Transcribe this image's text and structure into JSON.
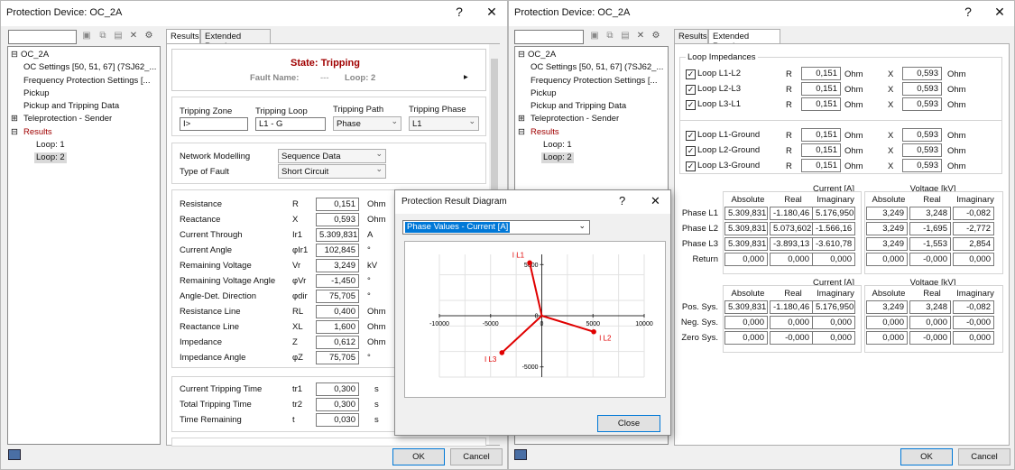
{
  "left": {
    "title": "Protection Device: OC_2A",
    "help": "?",
    "close": "✕",
    "tree": [
      {
        "label": "OC_2A"
      },
      {
        "label": "OC Settings [50, 51, 67] (7SJ62_..."
      },
      {
        "label": "Frequency Protection Settings [..."
      },
      {
        "label": "Pickup"
      },
      {
        "label": "Pickup and Tripping Data"
      },
      {
        "label": "Teleprotection - Sender"
      },
      {
        "label": "Results"
      },
      {
        "label": "Loop: 1"
      },
      {
        "label": "Loop: 2"
      }
    ],
    "tabs": [
      "Results",
      "Extended Results"
    ],
    "state": "State:  Tripping",
    "fault_name_label": "Fault Name:",
    "fault_name_value": "---",
    "loop_label": "Loop:  2",
    "arrow": "▸",
    "trip_headers": [
      "Tripping Zone",
      "Tripping Loop",
      "Tripping Path",
      "Tripping Phase"
    ],
    "trip_values": [
      "I>",
      "L1 - G",
      "Phase",
      "L1"
    ],
    "network_label": "Network Modelling",
    "network_value": "Sequence Data",
    "fault_type_label": "Type of Fault",
    "fault_type_value": "Short Circuit",
    "rows": [
      {
        "name": "Resistance",
        "sym": "R",
        "val": "0,151",
        "unit": "Ohm"
      },
      {
        "name": "Reactance",
        "sym": "X",
        "val": "0,593",
        "unit": "Ohm"
      },
      {
        "name": "Current Through",
        "sym": "Ir1",
        "val": "5.309,831",
        "unit": "A"
      },
      {
        "name": "Current Angle",
        "sym": "φIr1",
        "val": "102,845",
        "unit": "°"
      },
      {
        "name": "Remaining Voltage",
        "sym": "Vr",
        "val": "3,249",
        "unit": "kV"
      },
      {
        "name": "Remaining Voltage Angle",
        "sym": "φVr",
        "val": "-1,450",
        "unit": "°"
      },
      {
        "name": "Angle-Det. Direction",
        "sym": "φdir",
        "val": "75,705",
        "unit": "°"
      },
      {
        "name": "Resistance Line",
        "sym": "RL",
        "val": "0,400",
        "unit": "Ohm"
      },
      {
        "name": "Reactance Line",
        "sym": "XL",
        "val": "1,600",
        "unit": "Ohm"
      },
      {
        "name": "Impedance",
        "sym": "Z",
        "val": "0,612",
        "unit": "Ohm"
      },
      {
        "name": "Impedance Angle",
        "sym": "φZ",
        "val": "75,705",
        "unit": "°"
      }
    ],
    "time_rows": [
      {
        "name": "Current Tripping Time",
        "sym": "tr1",
        "val": "0,300",
        "unit": "s"
      },
      {
        "name": "Total Tripping Time",
        "sym": "tr2",
        "val": "0,300",
        "unit": "s"
      },
      {
        "name": "Time Remaining",
        "sym": "t",
        "val": "0,030",
        "unit": "s"
      }
    ],
    "ok": "OK",
    "cancel": "Cancel"
  },
  "dialog": {
    "title": "Protection Result Diagram",
    "help": "?",
    "close": "✕",
    "select_value": "Phase Values - Current [A]",
    "close_button": "Close"
  },
  "chart_data": {
    "type": "scatter",
    "title": "",
    "xlim": [
      -10000,
      10000
    ],
    "ylim": [
      -6000,
      6000
    ],
    "x_ticks": [
      -10000,
      -5000,
      0,
      5000,
      10000
    ],
    "y_ticks": [
      -5000,
      0,
      5000
    ],
    "series": [
      {
        "name": "I L1",
        "x": -1180.46,
        "y": 5176.95
      },
      {
        "name": "I L2",
        "x": 5073.602,
        "y": -1566.16
      },
      {
        "name": "I L3",
        "x": -3893.13,
        "y": -3610.78
      }
    ],
    "color": "#e00000"
  },
  "right": {
    "title": "Protection Device: OC_2A",
    "tabs": [
      "Results",
      "Extended Results"
    ],
    "loop_imp_title": "Loop Impedances",
    "loops": [
      {
        "name": "Loop L1-L2",
        "r": "0,151",
        "x": "0,593"
      },
      {
        "name": "Loop L2-L3",
        "r": "0,151",
        "x": "0,593"
      },
      {
        "name": "Loop L3-L1",
        "r": "0,151",
        "x": "0,593"
      },
      {
        "name": "Loop L1-Ground",
        "r": "0,151",
        "x": "0,593"
      },
      {
        "name": "Loop L2-Ground",
        "r": "0,151",
        "x": "0,593"
      },
      {
        "name": "Loop L3-Ground",
        "r": "0,151",
        "x": "0,593"
      }
    ],
    "r_label": "R",
    "x_label": "X",
    "ohm": "Ohm",
    "cur_title": "Current [A]",
    "volt_title": "Voltage [kV]",
    "cols": [
      "Absolute",
      "Real",
      "Imaginary"
    ],
    "phase_rows": [
      {
        "name": "Phase L1",
        "c": [
          "5.309,831",
          "-1.180,46",
          "5.176,950"
        ],
        "v": [
          "3,249",
          "3,248",
          "-0,082"
        ]
      },
      {
        "name": "Phase L2",
        "c": [
          "5.309,831",
          "5.073,602",
          "-1.566,16"
        ],
        "v": [
          "3,249",
          "-1,695",
          "-2,772"
        ]
      },
      {
        "name": "Phase L3",
        "c": [
          "5.309,831",
          "-3.893,13",
          "-3.610,78"
        ],
        "v": [
          "3,249",
          "-1,553",
          "2,854"
        ]
      },
      {
        "name": "Return",
        "c": [
          "0,000",
          "0,000",
          "0,000"
        ],
        "v": [
          "0,000",
          "-0,000",
          "0,000"
        ]
      }
    ],
    "seq_rows": [
      {
        "name": "Pos. Sys.",
        "c": [
          "5.309,831",
          "-1.180,46",
          "5.176,950"
        ],
        "v": [
          "3,249",
          "3,248",
          "-0,082"
        ]
      },
      {
        "name": "Neg. Sys.",
        "c": [
          "0,000",
          "0,000",
          "0,000"
        ],
        "v": [
          "0,000",
          "0,000",
          "-0,000"
        ]
      },
      {
        "name": "Zero Sys.",
        "c": [
          "0,000",
          "-0,000",
          "0,000"
        ],
        "v": [
          "0,000",
          "-0,000",
          "0,000"
        ]
      }
    ]
  }
}
